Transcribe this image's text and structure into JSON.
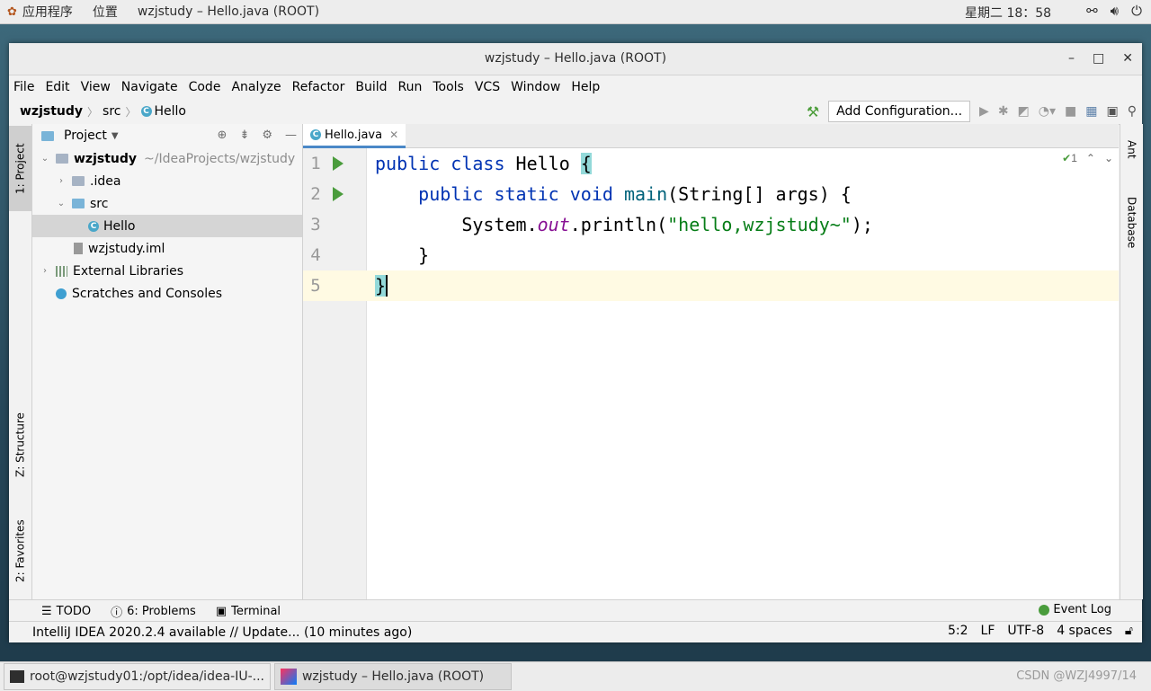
{
  "top_panel": {
    "apps_menu": "应用程序",
    "places_menu": "位置",
    "window_title": "wzjstudy – Hello.java (ROOT)",
    "clock": "星期二 18：58"
  },
  "window": {
    "title": "wzjstudy – Hello.java (ROOT)"
  },
  "menu": [
    "File",
    "Edit",
    "View",
    "Navigate",
    "Code",
    "Analyze",
    "Refactor",
    "Build",
    "Run",
    "Tools",
    "VCS",
    "Window",
    "Help"
  ],
  "breadcrumb": {
    "project": "wzjstudy",
    "folder": "src",
    "file": "Hello"
  },
  "toolbar": {
    "run_config_label": "Add Configuration..."
  },
  "left_tabs": {
    "project": "1: Project",
    "structure": "Z: Structure",
    "favorites": "2: Favorites"
  },
  "right_tabs": {
    "ant": "Ant",
    "database": "Database"
  },
  "project_panel": {
    "title": "Project",
    "tree": [
      {
        "label": "wzjstudy",
        "path": "~/IdeaProjects/wzjstudy"
      },
      {
        "label": ".idea"
      },
      {
        "label": "src"
      },
      {
        "label": "Hello"
      },
      {
        "label": "wzjstudy.iml"
      },
      {
        "label": "External Libraries"
      },
      {
        "label": "Scratches and Consoles"
      }
    ]
  },
  "editor": {
    "tab_label": "Hello.java",
    "inspection_count": "1",
    "line_numbers": [
      "1",
      "2",
      "3",
      "4",
      "5"
    ],
    "lines": [
      {
        "parts": [
          "public class ",
          "Hello ",
          "{"
        ]
      },
      {
        "parts": [
          "    public static void ",
          "main",
          "(String[] args) {"
        ]
      },
      {
        "parts": [
          "        System.",
          "out",
          ".println(",
          "\"hello,wzjstudy~\"",
          ");"
        ]
      },
      {
        "parts": [
          "    }"
        ]
      },
      {
        "parts": [
          "}"
        ]
      }
    ]
  },
  "tool_windows": {
    "todo": "TODO",
    "problems": "6: Problems",
    "terminal": "Terminal",
    "event_log": "Event Log"
  },
  "status": {
    "message": "IntelliJ IDEA 2020.2.4 available // Update... (10 minutes ago)",
    "position": "5:2",
    "line_sep": "LF",
    "encoding": "UTF-8",
    "indent": "4 spaces"
  },
  "taskbar": {
    "terminal_task": "root@wzjstudy01:/opt/idea/idea-IU-...",
    "ide_task": "wzjstudy – Hello.java (ROOT)",
    "watermark": "CSDN @WZJ4997/14"
  }
}
